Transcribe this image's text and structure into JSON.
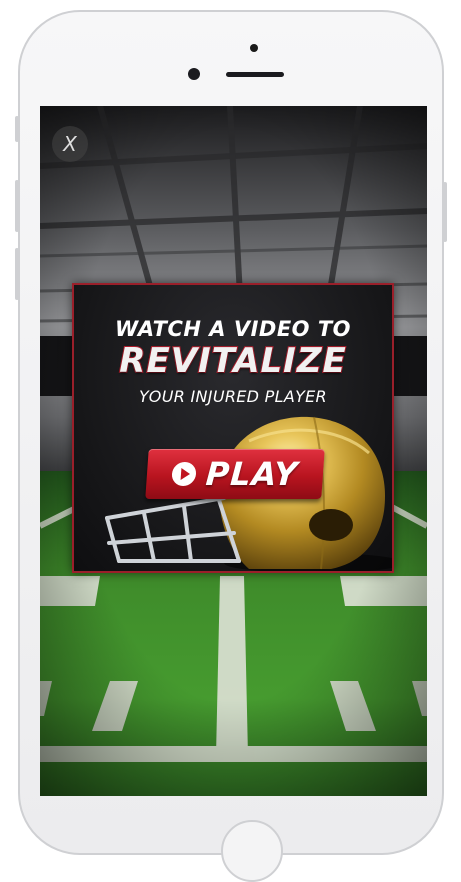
{
  "screen": {
    "close_label": "X"
  },
  "ad": {
    "line1": "WATCH A VIDEO TO",
    "line2": "REVITALIZE",
    "line3": "YOUR INJURED PLAYER",
    "play_label": "PLAY"
  },
  "icons": {
    "close": "close-icon",
    "play": "play-icon",
    "helmet": "football-helmet-icon"
  },
  "colors": {
    "accent_red": "#c0141f",
    "helmet_gold": "#c9a233",
    "field_green": "#3e8a2a"
  }
}
